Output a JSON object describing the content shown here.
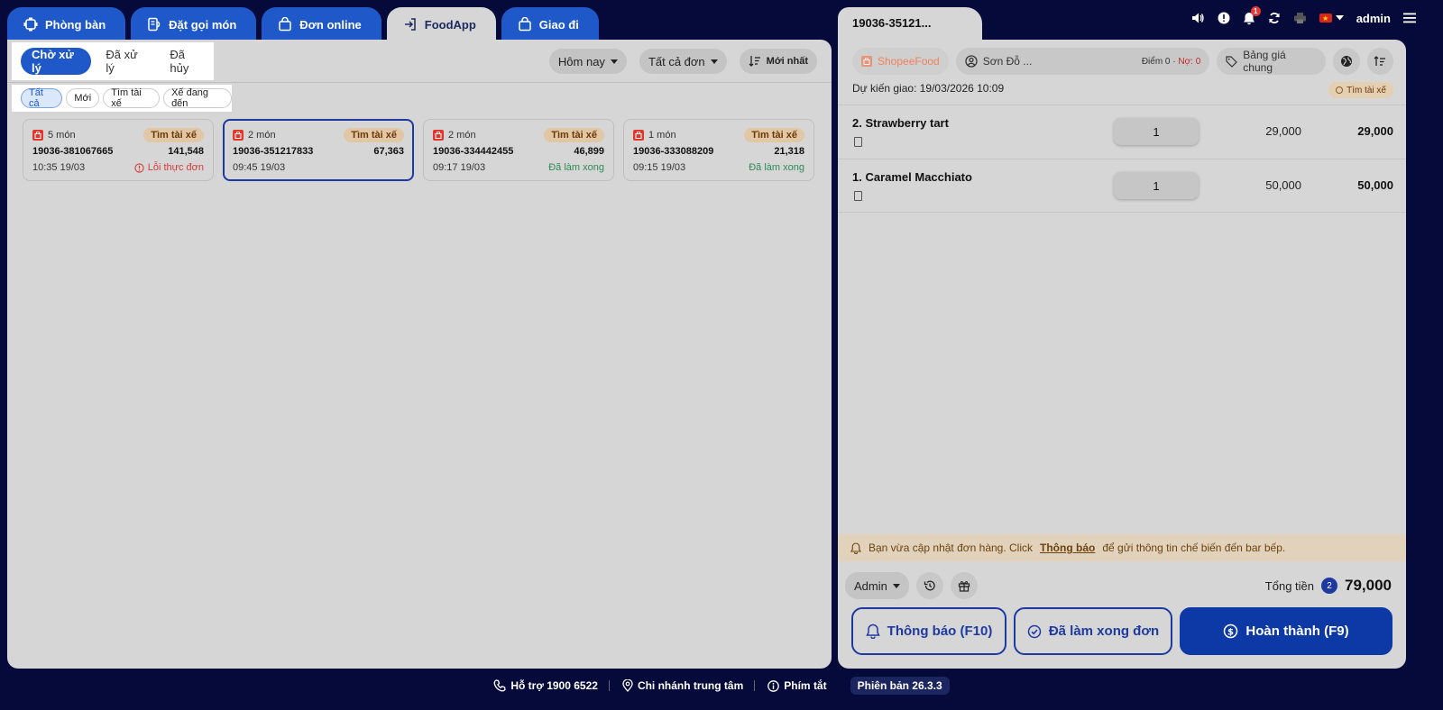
{
  "tabs": [
    {
      "label": "Phòng bàn",
      "icon": "table-icon"
    },
    {
      "label": "Đặt gọi món",
      "icon": "order-icon"
    },
    {
      "label": "Đơn online",
      "icon": "bag-icon"
    },
    {
      "label": "FoodApp",
      "icon": "login-icon"
    },
    {
      "label": "Giao đi",
      "icon": "bag-icon"
    }
  ],
  "left": {
    "status_tabs": [
      "Chờ xử lý",
      "Đã xử lý",
      "Đã hủy"
    ],
    "filter_date": "Hôm nay",
    "filter_orders": "Tất cả đơn",
    "sort_label": "Mới nhất",
    "chips": [
      "Tất cả",
      "Mới",
      "Tìm tài xế",
      "Xế đang đến"
    ],
    "cards": [
      {
        "count": "5 món",
        "badge": "Tìm tài xế",
        "code": "19036-381067665",
        "amount": "141,548",
        "time": "10:35 19/03",
        "status": "Lỗi thực đơn",
        "status_type": "error"
      },
      {
        "count": "2 món",
        "badge": "Tìm tài xế",
        "code": "19036-351217833",
        "amount": "67,363",
        "time": "09:45 19/03",
        "status": "",
        "status_type": "none"
      },
      {
        "count": "2 món",
        "badge": "Tìm tài xế",
        "code": "19036-334442455",
        "amount": "46,899",
        "time": "09:17 19/03",
        "status": "Đã làm xong",
        "status_type": "ok"
      },
      {
        "count": "1 món",
        "badge": "Tìm tài xế",
        "code": "19036-333088209",
        "amount": "21,318",
        "time": "09:15 19/03",
        "status": "Đã làm xong",
        "status_type": "ok"
      }
    ]
  },
  "right": {
    "tab_title": "19036-35121...",
    "topbar": {
      "notif_count": "1",
      "user": "admin"
    },
    "platform": "ShopeeFood",
    "customer": "Sơn Đỗ ...",
    "points_label": "Điểm 0 ·",
    "debt_label": "Nợ: 0",
    "price_list": "Bảng giá chung",
    "eta": "Dự kiến giao: 19/03/2026 10:09",
    "status": "Tìm tài xế",
    "items": [
      {
        "name": "2. Strawberry tart",
        "qty": "1",
        "price": "29,000",
        "total": "29,000"
      },
      {
        "name": "1. Caramel Macchiato",
        "qty": "1",
        "price": "50,000",
        "total": "50,000"
      }
    ],
    "warning_pre": "Bạn vừa cập nhật đơn hàng. Click",
    "warning_link": "Thông báo",
    "warning_post": "để gửi thông tin chế biến đến bar bếp.",
    "staff": "Admin",
    "total_label": "Tổng tiền",
    "total_count": "2",
    "total_value": "79,000",
    "btn_notify": "Thông báo (F10)",
    "btn_done": "Đã làm xong đơn",
    "btn_complete": "Hoàn thành (F9)"
  },
  "footer": {
    "support": "Hỗ trợ 1900 6522",
    "branch": "Chi nhánh trung tâm",
    "shortcuts": "Phím tắt",
    "version": "Phiên bản 26.3.3"
  },
  "colors": {
    "brand": "#1e58c9",
    "primary_dark": "#0d39a6",
    "background": "#050a3a",
    "panel": "#d6d6d6"
  }
}
